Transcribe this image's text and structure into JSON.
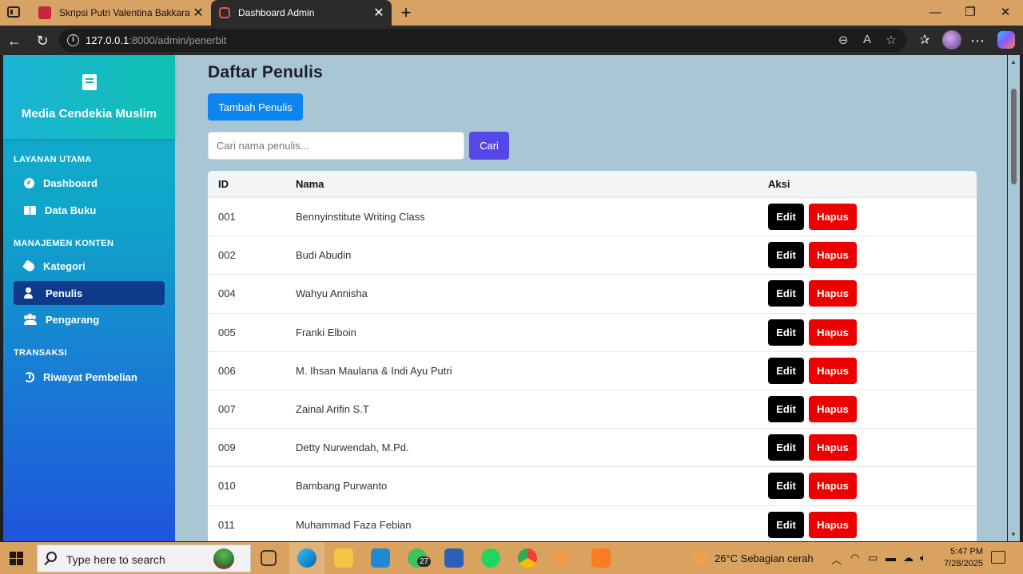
{
  "browser": {
    "tabs": [
      {
        "title": "Skripsi Putri Valentina Bakkara_21",
        "icon": "pdf-icon",
        "active": false
      },
      {
        "title": "Dashboard Admin",
        "icon": "laravel-icon",
        "active": true
      }
    ],
    "url_host": "127.0.0.1",
    "url_rest": ":8000/admin/penerbit"
  },
  "sidebar": {
    "brand": "Media Cendekia Muslim",
    "sections": [
      {
        "title": "LAYANAN UTAMA",
        "items": [
          {
            "label": "Dashboard",
            "icon": "gauge-icon"
          },
          {
            "label": "Data Buku",
            "icon": "book-open-icon"
          }
        ]
      },
      {
        "title": "MANAJEMEN KONTEN",
        "items": [
          {
            "label": "Kategori",
            "icon": "tag-icon"
          },
          {
            "label": "Penulis",
            "icon": "user-pen-icon",
            "active": true
          },
          {
            "label": "Pengarang",
            "icon": "users-icon"
          }
        ]
      },
      {
        "title": "TRANSAKSI",
        "items": [
          {
            "label": "Riwayat Pembelian",
            "icon": "history-icon"
          }
        ]
      }
    ]
  },
  "main": {
    "title": "Daftar Penulis",
    "add_button": "Tambah Penulis",
    "search_placeholder": "Cari nama penulis...",
    "search_button": "Cari",
    "columns": [
      "ID",
      "Nama",
      "Aksi"
    ],
    "edit_label": "Edit",
    "delete_label": "Hapus",
    "rows": [
      {
        "id": "001",
        "name": "Bennyinstitute Writing Class"
      },
      {
        "id": "002",
        "name": "Budi Abudin"
      },
      {
        "id": "004",
        "name": "Wahyu Annisha"
      },
      {
        "id": "005",
        "name": "Franki Elboin"
      },
      {
        "id": "006",
        "name": "M. Ihsan Maulana & Indi Ayu Putri"
      },
      {
        "id": "007",
        "name": "Zainal Arifin S.T"
      },
      {
        "id": "009",
        "name": "Detty Nurwendah, M.Pd."
      },
      {
        "id": "010",
        "name": "Bambang Purwanto"
      },
      {
        "id": "011",
        "name": "Muhammad Faza Febian"
      }
    ]
  },
  "taskbar": {
    "search_placeholder": "Type here to search",
    "whatsapp_badge": "27",
    "weather": "26°C  Sebagian cerah",
    "time": "5:47 PM",
    "date": "7/28/2025"
  },
  "colors": {
    "accent_blue": "#0d85ef",
    "search_purple": "#5548e6",
    "delete_red": "#ec0000",
    "sidebar_active": "#0e3a8c"
  }
}
